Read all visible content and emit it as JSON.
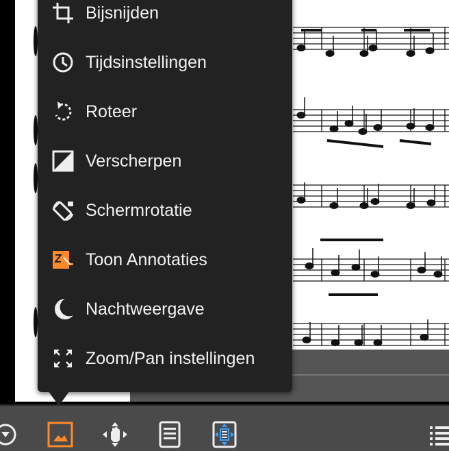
{
  "menu": {
    "items": [
      {
        "label": "Bijsnijden",
        "icon": "crop-icon"
      },
      {
        "label": "Tijdsinstellingen",
        "icon": "clock-icon"
      },
      {
        "label": "Roteer",
        "icon": "rotate-icon"
      },
      {
        "label": "Verscherpen",
        "icon": "sharpen-icon"
      },
      {
        "label": "Schermrotatie",
        "icon": "screen-rotation-icon"
      },
      {
        "label": "Toon Annotaties",
        "icon": "annotations-icon"
      },
      {
        "label": "Nachtweergave",
        "icon": "moon-icon"
      },
      {
        "label": "Zoom/Pan instellingen",
        "icon": "zoom-pan-icon"
      }
    ]
  },
  "toolbar": {
    "items": [
      {
        "icon": "dropdown-circle-icon"
      },
      {
        "icon": "image-icon",
        "active": true
      },
      {
        "icon": "pan-hand-icon"
      },
      {
        "icon": "page-icon"
      },
      {
        "icon": "fit-page-icon"
      },
      {
        "icon": "list-menu-icon"
      }
    ]
  },
  "colors": {
    "accent": "#ff8a2b",
    "menu_bg": "#222222",
    "toolbar_bg": "#4a4a4a",
    "text": "#f2f2f2"
  }
}
